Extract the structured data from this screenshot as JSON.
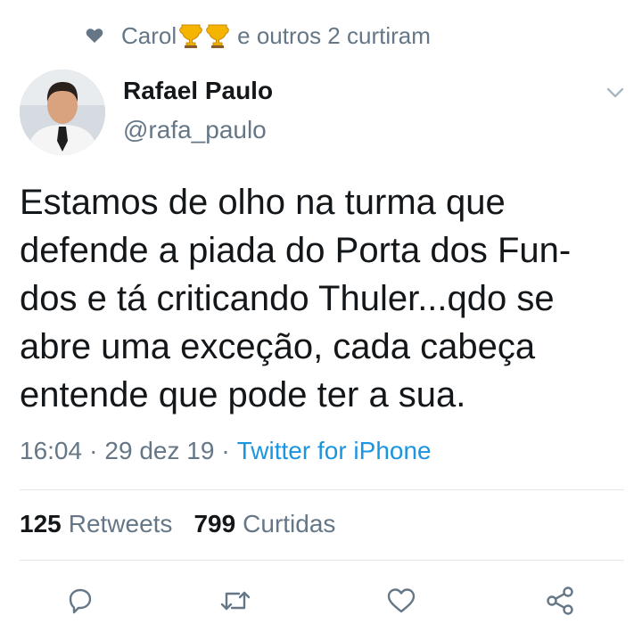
{
  "social_context": {
    "name": "Carol",
    "rest": "e outros 2 curtiram",
    "heart_icon": "heart-icon",
    "emojis": [
      "trophy-emoji",
      "trophy-emoji"
    ]
  },
  "author": {
    "name": "Rafael Paulo",
    "handle": "@rafa_paulo"
  },
  "tweet": {
    "text": "Estamos de olho na turma que\ndefende a piada do Porta dos Fun-\ndos e tá criticando Thuler...qdo se\nabre uma exceção, cada cabeça\nentende que pode ter a sua."
  },
  "meta": {
    "time": "16:04",
    "separator": "·",
    "date": "29 dez 19",
    "source": "Twitter for iPhone"
  },
  "stats": {
    "retweets_count": "125",
    "retweets_label": "Retweets",
    "likes_count": "799",
    "likes_label": "Curtidas"
  },
  "actions": [
    "reply-icon",
    "retweet-icon",
    "like-icon",
    "share-icon"
  ],
  "colors": {
    "accent": "#1b95e0",
    "secondary_text": "#657786",
    "primary_text": "#14171a",
    "divider": "#e1e8ed"
  }
}
